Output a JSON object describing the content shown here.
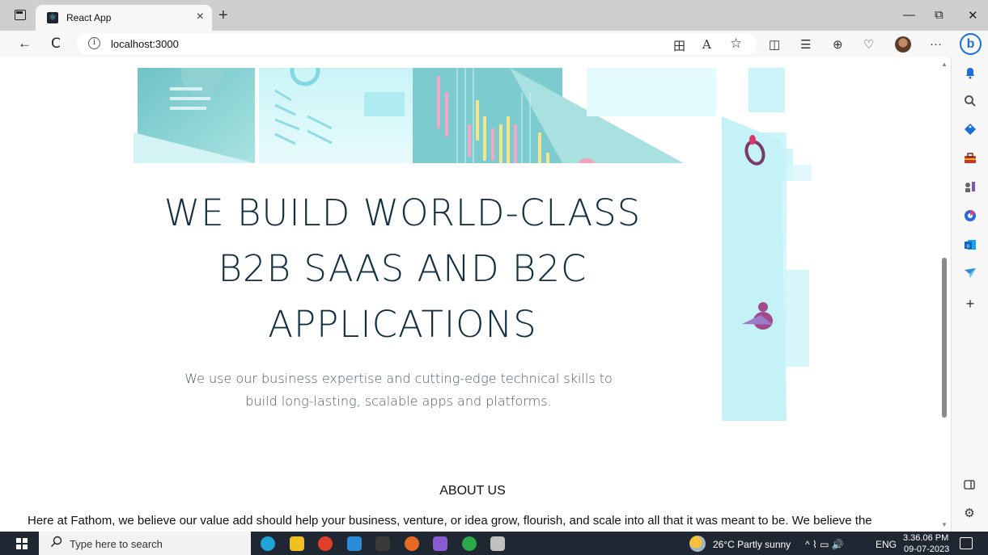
{
  "browser": {
    "tab": {
      "title": "React App",
      "close_icon": "×"
    },
    "new_tab_icon": "+",
    "window": {
      "minimize": "—",
      "restore": "⧉",
      "close": "✕"
    },
    "nav": {
      "back": "←",
      "refresh": "C"
    },
    "address": {
      "url": "localhost:3000",
      "info_icon": "i"
    },
    "toolbar_icons": [
      "grid-app-icon",
      "read-aloud-icon",
      "favorite-star-icon",
      "split-screen-icon",
      "favorites-list-icon",
      "collections-icon",
      "browser-essentials-icon"
    ],
    "toolbar_glyphs": {
      "apps": "田",
      "read_aloud": "A",
      "favorite": "☆",
      "split": "◫",
      "favorites": "☰",
      "collections": "⊕",
      "essentials": "♡",
      "more": "···"
    },
    "copilot_label": "b"
  },
  "sidebar": {
    "items": [
      {
        "name": "bell-icon",
        "glyph": "🔔",
        "color": "#1b6fd8"
      },
      {
        "name": "search-icon",
        "glyph": "🔍",
        "color": "#555"
      },
      {
        "name": "shopping-tag-icon",
        "glyph": "◆",
        "color": "#1b6fd8"
      },
      {
        "name": "tools-icon",
        "glyph": "▬",
        "color": "#c0392b"
      },
      {
        "name": "games-icon",
        "glyph": "♟",
        "color": "#555"
      },
      {
        "name": "office-icon",
        "glyph": "⬢",
        "color": "#2b6bd8"
      },
      {
        "name": "outlook-icon",
        "glyph": "▣",
        "color": "#0a64c8"
      },
      {
        "name": "send-icon",
        "glyph": "◤",
        "color": "#2a8bd8"
      },
      {
        "name": "add-icon",
        "glyph": "+",
        "color": "#333"
      }
    ],
    "bottom": {
      "panel": "◫",
      "settings": "⚙"
    }
  },
  "hero": {
    "title": "WE BUILD WORLD-CLASS B2B SAAS AND B2C APPLICATIONS",
    "subtitle": "We use our business expertise and cutting-edge technical skills to build long-lasting, scalable apps and platforms."
  },
  "about": {
    "title": "ABOUT US",
    "text": "Here at Fathom, we believe our value add should help your business, venture, or idea grow, flourish, and scale into all that it was meant to be. We believe the"
  },
  "taskbar": {
    "search_placeholder": "Type here to search",
    "weather": "26°C  Partly sunny",
    "language": "ENG",
    "time": "3.36.06 PM",
    "date": "09-07-2023",
    "tray_icons": "^  ⌇  ▭  🔊",
    "apps": [
      {
        "name": "edge-app-icon",
        "color": "#1fa3d8"
      },
      {
        "name": "file-explorer-app-icon",
        "color": "#f0c020"
      },
      {
        "name": "chrome-app-icon",
        "color": "#e0402a"
      },
      {
        "name": "vscode-app-icon",
        "color": "#2a8cd8"
      },
      {
        "name": "terminal-app-icon",
        "color": "#3a3a3a"
      },
      {
        "name": "firefox-app-icon",
        "color": "#e66a22"
      },
      {
        "name": "visual-studio-app-icon",
        "color": "#8a5ad0"
      },
      {
        "name": "mongodb-compass-app-icon",
        "color": "#2aa84a"
      },
      {
        "name": "paint-app-icon",
        "color": "#c0c0c0"
      }
    ]
  }
}
